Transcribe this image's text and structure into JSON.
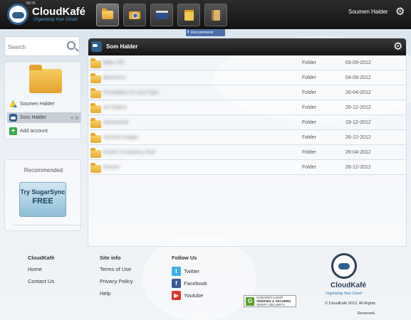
{
  "app": {
    "beta_label": "BETA",
    "name": "CloudKafé",
    "tagline": "Organizing Your Cloud!"
  },
  "topnav": {
    "tabs": [
      {
        "icon": "folder-icon",
        "active": true
      },
      {
        "icon": "camera-icon",
        "active": false
      },
      {
        "icon": "video-icon",
        "active": false
      },
      {
        "icon": "note-icon",
        "active": false
      },
      {
        "icon": "document-icon",
        "active": false
      }
    ],
    "user_name": "Soumen Halder",
    "settings_icon": "gear-icon"
  },
  "facebook": {
    "f_label": "f",
    "recommend_label": "Recommend"
  },
  "search": {
    "placeholder": "Search"
  },
  "accounts": {
    "items": [
      {
        "label": "Soumen Halder",
        "icon": "google-drive-icon",
        "selected": false
      },
      {
        "label": "Som Halder",
        "icon": "cloudkafe-icon",
        "selected": true
      },
      {
        "label": "Add account",
        "icon": "add-icon",
        "selected": false
      }
    ]
  },
  "recommended": {
    "title": "Recommended",
    "ad_line1": "Try SugarSync",
    "ad_line2": "FREE"
  },
  "main": {
    "title": "Som Halder",
    "files": [
      {
        "name": "Mais LPC",
        "type": "Folder",
        "date": "03-09-2012"
      },
      {
        "name": "Brochures",
        "type": "Folder",
        "date": "04-09-2012"
      },
      {
        "name": "Foundation of Lazy Caps",
        "type": "Folder",
        "date": "26-04-2012"
      },
      {
        "name": "Art Gallery",
        "type": "Folder",
        "date": "26-12-2012"
      },
      {
        "name": "Documents",
        "type": "Folder",
        "date": "19-12-2012"
      },
      {
        "name": "General Images",
        "type": "Folder",
        "date": "26-12-2012"
      },
      {
        "name": "Mobile Computing Stuff",
        "type": "Folder",
        "date": "26-04-2012"
      },
      {
        "name": "Shared",
        "type": "Folder",
        "date": "26-12-2012"
      }
    ]
  },
  "footer": {
    "col1": {
      "heading": "CloudKafé",
      "links": [
        "Home",
        "Contact Us"
      ]
    },
    "col2": {
      "heading": "Site info",
      "links": [
        "Terms of Use",
        "Privacy Policy",
        "Help"
      ]
    },
    "col3": {
      "heading": "Follow Us",
      "links": [
        "Twitter",
        "Facebook",
        "Youtube"
      ]
    },
    "godaddy_g": "G",
    "godaddy_line1": "GODADDY.COM®",
    "godaddy_line2": "VERIFIED & SECURED",
    "godaddy_line3": "VERIFY SECURITY",
    "logo_text": "CloudKafé",
    "logo_tagline": "Organizing Your Cloud!",
    "copyright_line1": "© CloudKafé 2012. All Rights",
    "copyright_line2": "Reserved."
  },
  "colors": {
    "accent": "#2b5f8f",
    "topbar": "#1a1a1a",
    "folder": "#e7a92c"
  }
}
